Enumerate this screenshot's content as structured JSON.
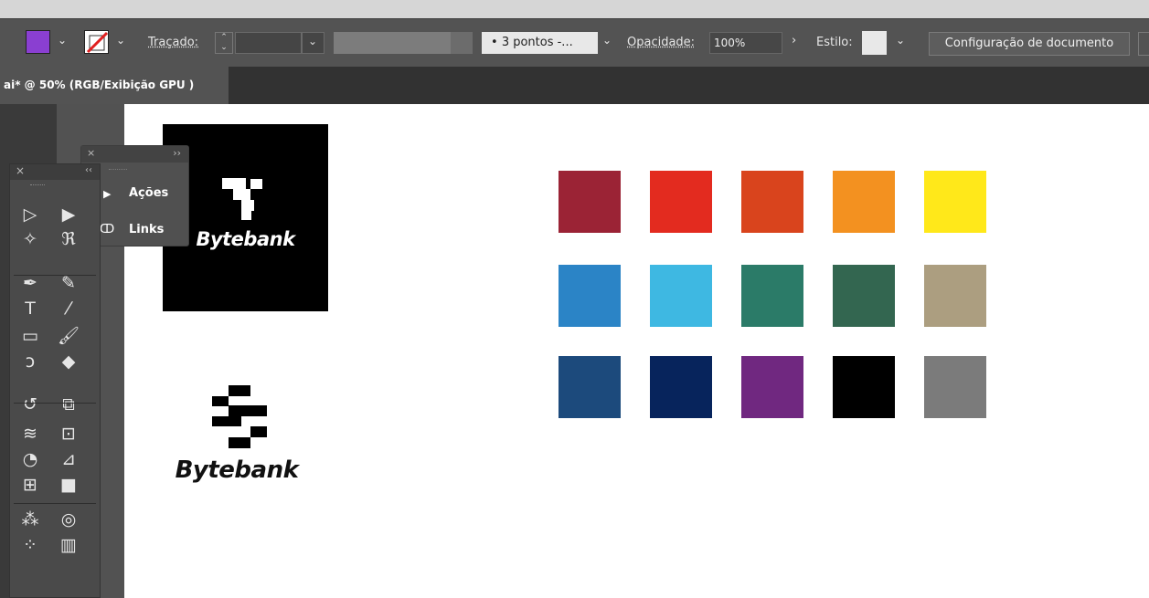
{
  "toolbar": {
    "fill_color": "#8a3fd1",
    "stroke_label": "Traçado:",
    "stroke_profile": "3 pontos -...",
    "opacity_label": "Opacidade:",
    "opacity_value": "100%",
    "style_label": "Estilo:",
    "doc_settings_label": "Configuração de documento",
    "chevron_icon": "chevron-down-icon",
    "arrow_icon": "chevron-right-icon"
  },
  "document_tab": {
    "title": "ai* @ 50% (RGB/Exibição GPU )"
  },
  "actions_panel": {
    "items": [
      {
        "label": "Ações",
        "icon": "play-icon"
      },
      {
        "label": "Links",
        "icon": "link-icon"
      }
    ]
  },
  "tools_panel": {
    "close_glyph": "×",
    "collapse_glyph": "‹‹",
    "tools": [
      {
        "name": "selection-tool",
        "glyph": "▷"
      },
      {
        "name": "direct-selection-tool",
        "glyph": "▶"
      },
      {
        "name": "magic-wand-tool",
        "glyph": "✧"
      },
      {
        "name": "lasso-tool",
        "glyph": "ℜ"
      },
      {
        "name": "pen-tool",
        "glyph": "✒"
      },
      {
        "name": "curvature-tool",
        "glyph": "✎"
      },
      {
        "name": "type-tool",
        "glyph": "T"
      },
      {
        "name": "line-tool",
        "glyph": "⁄"
      },
      {
        "name": "rectangle-tool",
        "glyph": "▭"
      },
      {
        "name": "paintbrush-tool",
        "glyph": "🖌"
      },
      {
        "name": "shaper-tool",
        "glyph": "ↄ"
      },
      {
        "name": "eraser-tool",
        "glyph": "◆"
      },
      {
        "name": "rotate-tool",
        "glyph": "↺"
      },
      {
        "name": "scale-tool",
        "glyph": "⧉"
      },
      {
        "name": "width-tool",
        "glyph": "≋"
      },
      {
        "name": "free-transform-tool",
        "glyph": "⊡"
      },
      {
        "name": "shape-builder-tool",
        "glyph": "◔"
      },
      {
        "name": "perspective-grid-tool",
        "glyph": "⊿"
      },
      {
        "name": "mesh-tool",
        "glyph": "⊞"
      },
      {
        "name": "gradient-tool",
        "glyph": "■"
      },
      {
        "name": "eyedropper-tool",
        "glyph": "⁂"
      },
      {
        "name": "blend-tool",
        "glyph": "◎"
      },
      {
        "name": "symbol-sprayer-tool",
        "glyph": "⁘"
      },
      {
        "name": "column-graph-tool",
        "glyph": "▥"
      }
    ]
  },
  "artwork": {
    "logo_dark_text": "Bytebank",
    "logo_light_text": "Bytebank",
    "swatches": [
      [
        "#9b2335",
        "#e32b1f",
        "#d9441d",
        "#f39120",
        "#ffe81a"
      ],
      [
        "#2b84c6",
        "#3eb8e2",
        "#2b7b68",
        "#336650",
        "#ac9e80"
      ],
      [
        "#1c4a7c",
        "#07245c",
        "#702880",
        "#000000",
        "#7b7b7b"
      ]
    ]
  }
}
